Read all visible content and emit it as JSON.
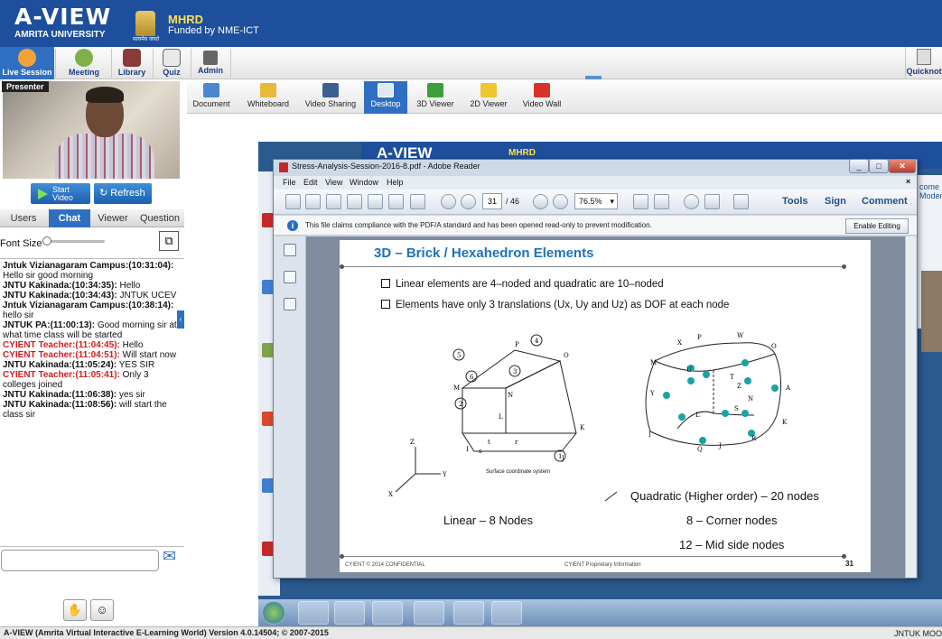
{
  "header": {
    "logo_title": "A-VIEW",
    "logo_subtitle": "AMRITA UNIVERSITY",
    "emblem_caption": "सत्यमेव जयते",
    "mhrd": "MHRD",
    "funded": "Funded by NME-ICT"
  },
  "nav": {
    "items": [
      {
        "label": "Live Session",
        "icon": "live-session-icon",
        "active": true
      },
      {
        "label": "Meeting",
        "icon": "meeting-icon"
      },
      {
        "label": "Library",
        "icon": "library-icon"
      },
      {
        "label": "Quiz",
        "icon": "quiz-icon"
      },
      {
        "label": "Admin",
        "icon": "admin-icon"
      }
    ],
    "quicknote": "Quicknot"
  },
  "presenter": {
    "tag": "Presenter",
    "start_video_line1": "Start",
    "start_video_line2": "Video",
    "refresh": "Refresh"
  },
  "side_tabs": [
    "Users",
    "Chat",
    "Viewer",
    "Question"
  ],
  "font_size_label": "Font Size",
  "chat": [
    {
      "sender": "Jntuk Vizianagaram Campus:(10:31:04):",
      "text": "Hello sir good morning",
      "teacher": false
    },
    {
      "sender": "JNTU Kakinada:(10:34:35):",
      "text": "Hello",
      "teacher": false
    },
    {
      "sender": "JNTU Kakinada:(10:34:43):",
      "text": "JNTUK UCEV",
      "teacher": false
    },
    {
      "sender": "Jntuk Vizianagaram Campus:(10:38:14):",
      "text": "hello sir",
      "teacher": false
    },
    {
      "sender": "JNTUK PA:(11:00:13):",
      "text": "Good morning sir at what time class will be started",
      "teacher": false
    },
    {
      "sender": "CYIENT Teacher:(11:04:45):",
      "text": "Hello",
      "teacher": true
    },
    {
      "sender": "CYIENT Teacher:(11:04:51):",
      "text": "Will start now",
      "teacher": true
    },
    {
      "sender": "JNTU Kakinada:(11:05:24):",
      "text": "YES SIR",
      "teacher": false
    },
    {
      "sender": "CYIENT Teacher:(11:05:41):",
      "text": "Only 3 colleges joined",
      "teacher": true
    },
    {
      "sender": "JNTU Kakinada:(11:06:38):",
      "text": "yes sir",
      "teacher": false
    },
    {
      "sender": "JNTU Kakinada:(11:08:56):",
      "text": "will start the class sir",
      "teacher": false
    }
  ],
  "tools": [
    {
      "label": "Document",
      "icon": "document-icon"
    },
    {
      "label": "Whiteboard",
      "icon": "whiteboard-icon"
    },
    {
      "label": "Video Sharing",
      "icon": "video-sharing-icon"
    },
    {
      "label": "Desktop",
      "icon": "desktop-icon",
      "active": true
    },
    {
      "label": "3D Viewer",
      "icon": "3d-viewer-icon"
    },
    {
      "label": "2D Viewer",
      "icon": "2d-viewer-icon"
    },
    {
      "label": "Video Wall",
      "icon": "video-wall-icon"
    }
  ],
  "remote": {
    "logo": "A-VIEW",
    "mhrd": "MHRD",
    "right_text_1": "come",
    "right_text_2": "Moder"
  },
  "adobe": {
    "title": "Stress-Analysis-Session-2016-8.pdf - Adobe Reader",
    "menu": [
      "File",
      "Edit",
      "View",
      "Window",
      "Help"
    ],
    "page_current": "31",
    "page_total": "/ 46",
    "zoom": "76.5%",
    "tools": "Tools",
    "sign": "Sign",
    "comment": "Comment",
    "info": "This file claims compliance with the PDF/A standard and has been opened read-only to prevent modification.",
    "enable_editing": "Enable Editing"
  },
  "slide": {
    "title": "3D – Brick / Hexahedron Elements",
    "bullets": [
      "Linear elements are 4–noded and quadratic are 10–noded",
      "Elements have only 3 translations (Ux, Uy and Uz) as DOF at each node"
    ],
    "linear_caption": "Linear – 8 Nodes",
    "surface_caption": "Surface coordinate system",
    "quadratic_caption": "Quadratic (Higher order) – 20 nodes",
    "corner_caption": "8 – Corner nodes",
    "midside_caption": "12 – Mid side nodes",
    "footer_left": "CYIENT © 2014 CONFIDENTIAL",
    "footer_center": "CYIENT Proprietary Information",
    "page_number": "31",
    "node_labels_linear": [
      "P",
      "O",
      "M",
      "N",
      "K",
      "L",
      "I",
      "J",
      "Z",
      "Y",
      "X",
      "s",
      "t",
      "r"
    ],
    "node_labels_quad": [
      "X",
      "P",
      "W",
      "O",
      "M",
      "U",
      "T",
      "Z",
      "Y",
      "L",
      "S",
      "A",
      "K",
      "R",
      "Q",
      "J",
      "I",
      "N"
    ],
    "face_numbers": [
      "1",
      "2",
      "3",
      "4",
      "5",
      "6"
    ],
    "axis_labels": [
      "Z",
      "Y",
      "X"
    ]
  },
  "status": {
    "left": "A-VIEW (Amrita Virtual Interactive E-Learning World) Version 4.0.14504; © 2007-2015",
    "right": "JNTUK MOO"
  }
}
